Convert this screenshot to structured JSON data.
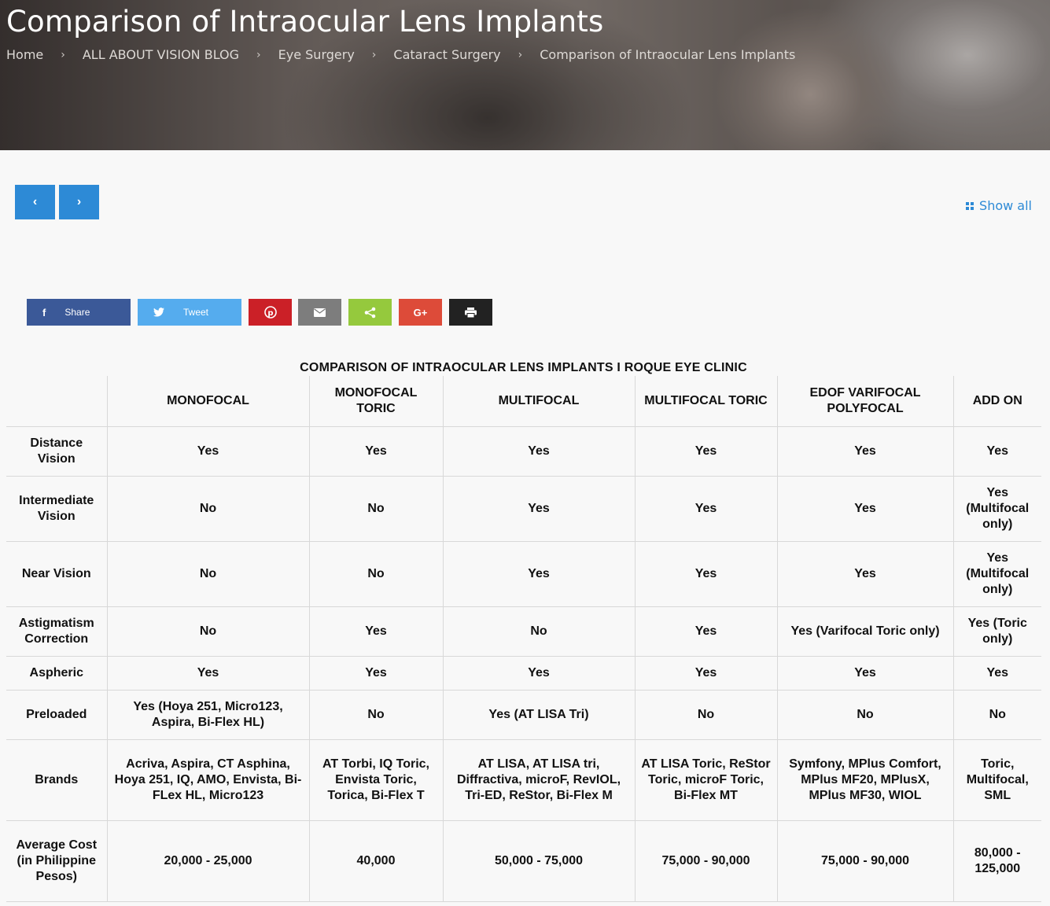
{
  "header": {
    "title": "Comparison of Intraocular Lens Implants",
    "breadcrumb": [
      "Home",
      "ALL ABOUT VISION BLOG",
      "Eye Surgery",
      "Cataract Surgery",
      "Comparison of Intraocular Lens Implants"
    ]
  },
  "nav": {
    "prev_icon": "‹",
    "next_icon": "›",
    "show_all": "Show all"
  },
  "share": {
    "facebook_label": "Share",
    "twitter_label": "Tweet",
    "colors": {
      "facebook": "#3b5998",
      "twitter": "#55acee",
      "pinterest": "#cb2027",
      "email": "#7d7d7d",
      "share": "#95c93d",
      "google": "#dd4b39",
      "print": "#222222"
    }
  },
  "table": {
    "title": "COMPARISON OF INTRAOCULAR LENS IMPLANTS I ROQUE EYE CLINIC",
    "columns": [
      "",
      "MONOFOCAL",
      "MONOFOCAL TORIC",
      "MULTIFOCAL",
      "MULTIFOCAL TORIC",
      "EDOF VARIFOCAL POLYFOCAL",
      "ADD ON"
    ],
    "rows": [
      [
        "Distance Vision",
        "Yes",
        "Yes",
        "Yes",
        "Yes",
        "Yes",
        "Yes"
      ],
      [
        "Intermediate Vision",
        "No",
        "No",
        "Yes",
        "Yes",
        "Yes",
        "Yes (Multifocal only)"
      ],
      [
        "Near Vision",
        "No",
        "No",
        "Yes",
        "Yes",
        "Yes",
        "Yes (Multifocal only)"
      ],
      [
        "Astigmatism Correction",
        "No",
        "Yes",
        "No",
        "Yes",
        "Yes (Varifocal Toric only)",
        "Yes (Toric only)"
      ],
      [
        "Aspheric",
        "Yes",
        "Yes",
        "Yes",
        "Yes",
        "Yes",
        "Yes"
      ],
      [
        "Preloaded",
        "Yes (Hoya 251, Micro123, Aspira, Bi-Flex HL)",
        "No",
        "Yes (AT LISA Tri)",
        "No",
        "No",
        "No"
      ],
      [
        "Brands",
        "Acriva, Aspira, CT Asphina, Hoya 251, IQ, AMO, Envista, Bi-FLex HL, Micro123",
        "AT Torbi, IQ Toric, Envista Toric, Torica, Bi-Flex T",
        "AT LISA, AT LISA tri, Diffractiva, microF, RevIOL, Tri-ED, ReStor, Bi-Flex M",
        "AT LISA Toric, ReStor Toric, microF Toric, Bi-Flex MT",
        "Symfony, MPlus Comfort, MPlus MF20, MPlusX, MPlus MF30, WIOL",
        "Toric, Multifocal, SML"
      ],
      [
        "Average Cost (in Philippine Pesos)",
        "20,000 - 25,000",
        "40,000",
        "50,000 - 75,000",
        "75,000 - 90,000",
        "75,000 - 90,000",
        "80,000 - 125,000"
      ]
    ]
  }
}
